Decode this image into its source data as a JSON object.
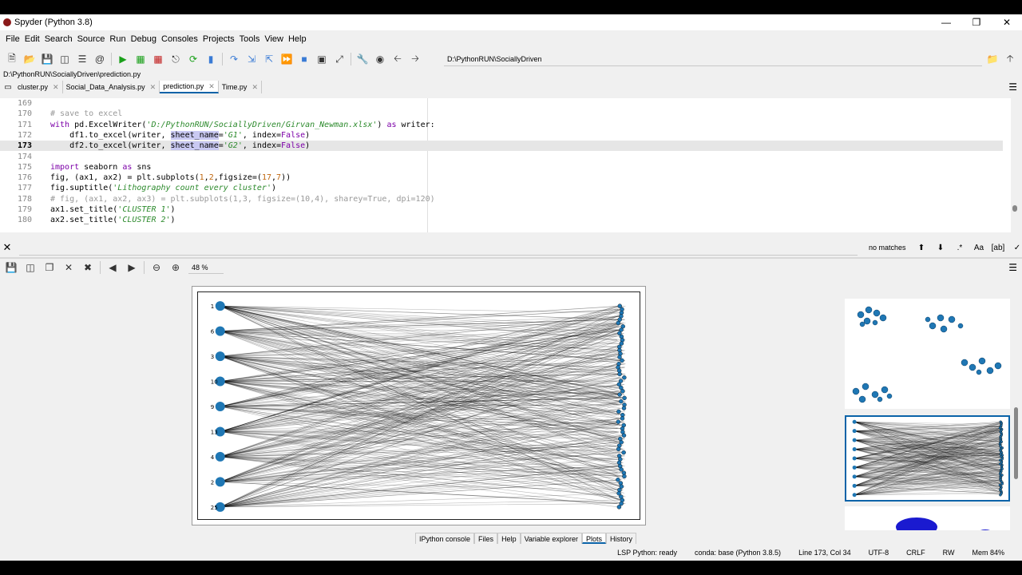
{
  "window": {
    "title": "Spyder (Python 3.8)"
  },
  "menu": [
    "File",
    "Edit",
    "Search",
    "Source",
    "Run",
    "Debug",
    "Consoles",
    "Projects",
    "Tools",
    "View",
    "Help"
  ],
  "toolbar": {
    "path": "D:\\PythonRUN\\SociallyDriven"
  },
  "editor": {
    "filepath": "D:\\PythonRUN\\SociallyDriven\\prediction.py",
    "tabs": [
      {
        "label": "cluster.py",
        "active": false
      },
      {
        "label": "Social_Data_Analysis.py",
        "active": false
      },
      {
        "label": "prediction.py",
        "active": true
      },
      {
        "label": "Time.py",
        "active": false
      }
    ],
    "line_numbers": [
      "169",
      "170",
      "171",
      "172",
      "173",
      "174",
      "175",
      "176",
      "177",
      "178",
      "179",
      "180"
    ],
    "current_line": "173"
  },
  "find": {
    "status": "no matches",
    "case_label": "Aa"
  },
  "plots": {
    "zoom": "48 %"
  },
  "figure": {
    "left_labels": [
      "1",
      "6",
      "3",
      "10",
      "9",
      "13",
      "4",
      "2",
      "25"
    ]
  },
  "pane_tabs": [
    {
      "label": "IPython console",
      "active": false
    },
    {
      "label": "Files",
      "active": false
    },
    {
      "label": "Help",
      "active": false
    },
    {
      "label": "Variable explorer",
      "active": false
    },
    {
      "label": "Plots",
      "active": true
    },
    {
      "label": "History",
      "active": false
    }
  ],
  "status": {
    "lsp": "LSP Python: ready",
    "conda": "conda: base (Python 3.8.5)",
    "position": "Line 173, Col 34",
    "encoding": "UTF-8",
    "eol": "CRLF",
    "rw": "RW",
    "mem": "Mem 84%"
  },
  "colors": {
    "accent": "#0a63a8",
    "node": "#1f77b4"
  }
}
